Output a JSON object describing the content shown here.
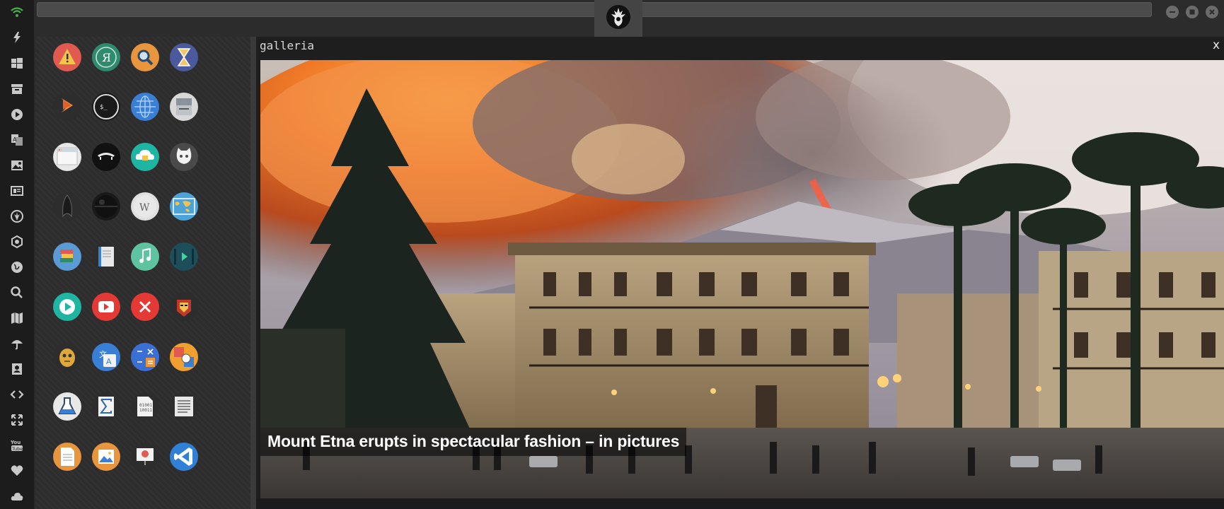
{
  "dock": {
    "items": [
      {
        "icon": "wifi-icon"
      },
      {
        "icon": "lightning-icon"
      },
      {
        "icon": "windows-icon"
      },
      {
        "icon": "archive-icon"
      },
      {
        "icon": "play-circle-icon"
      },
      {
        "icon": "translate-icon"
      },
      {
        "icon": "image-icon"
      },
      {
        "icon": "newspaper-icon"
      },
      {
        "icon": "rebel-icon"
      },
      {
        "icon": "empire-icon"
      },
      {
        "icon": "globe-icon"
      },
      {
        "icon": "search-icon"
      },
      {
        "icon": "map-icon"
      },
      {
        "icon": "umbrella-icon"
      },
      {
        "icon": "contact-icon"
      },
      {
        "icon": "code-icon"
      },
      {
        "icon": "expand-icon"
      },
      {
        "icon": "youtube-icon"
      },
      {
        "icon": "heart-icon"
      },
      {
        "icon": "cloud-icon"
      }
    ]
  },
  "window": {
    "tab_icon": "rebel-alliance-icon"
  },
  "apps": [
    {
      "icon": "warning-icon",
      "color": "#e05a4f"
    },
    {
      "icon": "yandex-icon",
      "color": "#2e8b6e"
    },
    {
      "icon": "search-icon",
      "color": "#e8953d"
    },
    {
      "icon": "hourglass-icon",
      "color": "#4a5a9c"
    },
    {
      "icon": "sublime-icon",
      "color": "#2d2d2d"
    },
    {
      "icon": "terminal-icon",
      "color": "#1a1a1a"
    },
    {
      "icon": "globe-icon",
      "color": "#3a7fd6"
    },
    {
      "icon": "drive-icon",
      "color": "#d8d8d8"
    },
    {
      "icon": "window-icon",
      "color": "#e8e8e8"
    },
    {
      "icon": "dracula-icon",
      "color": "#111111"
    },
    {
      "icon": "cloud-lock-icon",
      "color": "#1fb5a3"
    },
    {
      "icon": "github-icon",
      "color": "#4a4a4a"
    },
    {
      "icon": "startrek-icon",
      "color": "#2d2d2d"
    },
    {
      "icon": "deathstar-icon",
      "color": "#1a1a1a"
    },
    {
      "icon": "wikipedia-icon",
      "color": "#e0e0e0"
    },
    {
      "icon": "world-map-icon",
      "color": "#4ca3d8"
    },
    {
      "icon": "books-icon",
      "color": "#5b9bd5"
    },
    {
      "icon": "notebook-icon",
      "color": "#2d2d2d"
    },
    {
      "icon": "music-icon",
      "color": "#5ec4a0"
    },
    {
      "icon": "video-icon",
      "color": "#1e4e5a"
    },
    {
      "icon": "play-icon",
      "color": "#1fb5a3"
    },
    {
      "icon": "youtube-icon",
      "color": "#e53935"
    },
    {
      "icon": "close-circle-icon",
      "color": "#e53935"
    },
    {
      "icon": "ironman-icon",
      "color": "#2d2d2d"
    },
    {
      "icon": "c3po-icon",
      "color": "#2d2d2d"
    },
    {
      "icon": "translate-icon",
      "color": "#3a7fd6"
    },
    {
      "icon": "calculator-icon",
      "color": "#3a6fd6"
    },
    {
      "icon": "photo-gallery-icon",
      "color": "#f0a030"
    },
    {
      "icon": "flask-icon",
      "color": "#e8e8e8"
    },
    {
      "icon": "sigma-icon",
      "color": "#2d2d2d"
    },
    {
      "icon": "binary-file-icon",
      "color": "#2d2d2d"
    },
    {
      "icon": "text-lines-icon",
      "color": "#2d2d2d"
    },
    {
      "icon": "document-icon",
      "color": "#e8953d"
    },
    {
      "icon": "picture-icon",
      "color": "#e8953d"
    },
    {
      "icon": "presentation-icon",
      "color": "#2d2d2d"
    },
    {
      "icon": "vscode-icon",
      "color": "#2f80d6"
    }
  ],
  "gallery": {
    "title": "galleria",
    "close_label": "x",
    "caption": "Mount Etna erupts in spectacular fashion – in pictures"
  }
}
